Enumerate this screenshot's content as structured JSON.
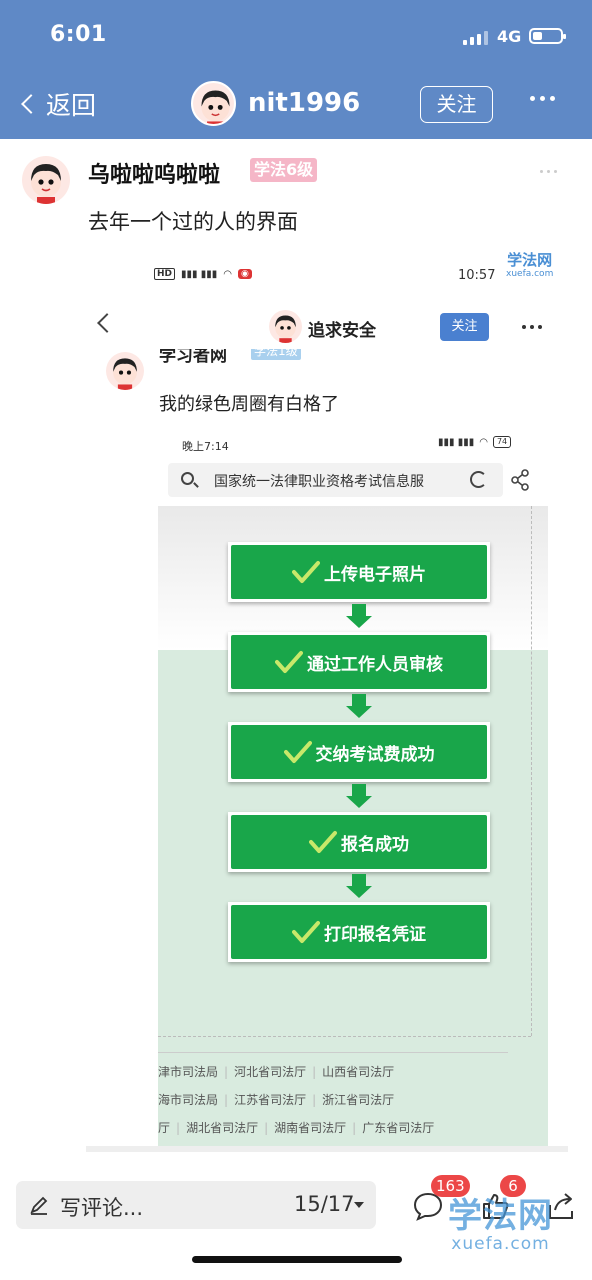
{
  "status_bar": {
    "time": "6:01",
    "network": "4G"
  },
  "header": {
    "back_label": "返回",
    "username": "nit1996",
    "follow_label": "关注"
  },
  "post": {
    "author": "乌啦啦呜啦啦",
    "level": "学法6级",
    "text": "去年一个过的人的界面"
  },
  "screenshot": {
    "status_left": "HD",
    "status_right": "10:57",
    "watermark_title": "学法网",
    "watermark_url": "xuefa.com",
    "username": "追求安全",
    "follow_label": "关注",
    "cut_author": "学习者网",
    "cut_level": "学法1级",
    "text": "我的绿色周圈有白格了",
    "inner": {
      "time": "晚上7:14",
      "battery": "74",
      "search_text": "国家统一法律职业资格考试信息服",
      "steps": [
        "上传电子照片",
        "通过工作人员审核",
        "交纳考试费成功",
        "报名成功",
        "打印报名凭证"
      ],
      "link_rows": [
        [
          "津市司法局",
          "河北省司法厅",
          "山西省司法厅"
        ],
        [
          "海市司法局",
          "江苏省司法厅",
          "浙江省司法厅"
        ],
        [
          "厅",
          "湖北省司法厅",
          "湖南省司法厅",
          "广东省司法厅"
        ]
      ]
    }
  },
  "bottom_bar": {
    "comment_placeholder": "写评论...",
    "pager": "15/17",
    "comment_count": "163",
    "like_count": "6"
  },
  "watermark": {
    "title": "学法网",
    "url": "xuefa.com"
  },
  "colors": {
    "header_bg": "#5f89c6",
    "step_green": "#19a64a",
    "badge_red": "#ec4747",
    "level_pink": "#f5b6c7"
  }
}
